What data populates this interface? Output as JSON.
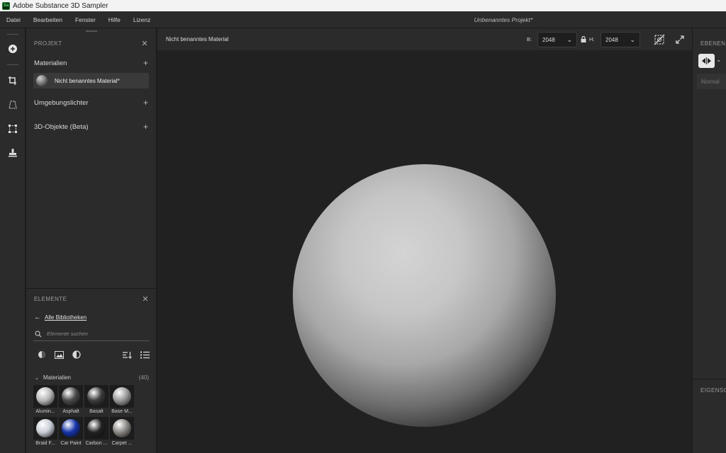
{
  "window": {
    "title": "Adobe Substance 3D Sampler",
    "logo_text": "Sa"
  },
  "menu": {
    "items": [
      "Datei",
      "Bearbeiten",
      "Fenster",
      "Hilfe",
      "Lizenz"
    ],
    "project_title": "Unbenanntes Projekt*"
  },
  "toolbar": {
    "tools": [
      "add-icon",
      "crop-icon",
      "perspective-icon",
      "transform-icon",
      "stamp-icon"
    ]
  },
  "project_panel": {
    "header": "PROJEKT",
    "materials_label": "Materialien",
    "selected_material": "Nicht benanntes Material*",
    "lights_label": "Umgebungslichter",
    "objects_label": "3D-Objekte (Beta)"
  },
  "elements_panel": {
    "header": "ELEMENTE",
    "back_link": "Alle Bibliotheken",
    "search_placeholder": "Elemente suchen",
    "category": "Materialien",
    "count": "(40)",
    "items": [
      {
        "label": "Alumin...",
        "color": "#b8b8b8"
      },
      {
        "label": "Asphalt",
        "color": "#4a4a4a"
      },
      {
        "label": "Basalt",
        "color": "#3c3c3c"
      },
      {
        "label": "Base M...",
        "color": "#9a9a9a"
      },
      {
        "label": "Braid F...",
        "color": "#c9cdd6"
      },
      {
        "label": "Car Paint",
        "color": "#1633a8"
      },
      {
        "label": "Carbon ...",
        "color": "#222222"
      },
      {
        "label": "Carpet ...",
        "color": "#8a8784"
      }
    ]
  },
  "viewport": {
    "material_name": "Nicht benanntes Material",
    "width_label": "B:",
    "width_value": "2048",
    "height_label": "H:",
    "height_value": "2048"
  },
  "right_panel": {
    "layers_header": "EBENEN",
    "blend_mode": "Normal",
    "properties_header": "EIGENSC"
  }
}
